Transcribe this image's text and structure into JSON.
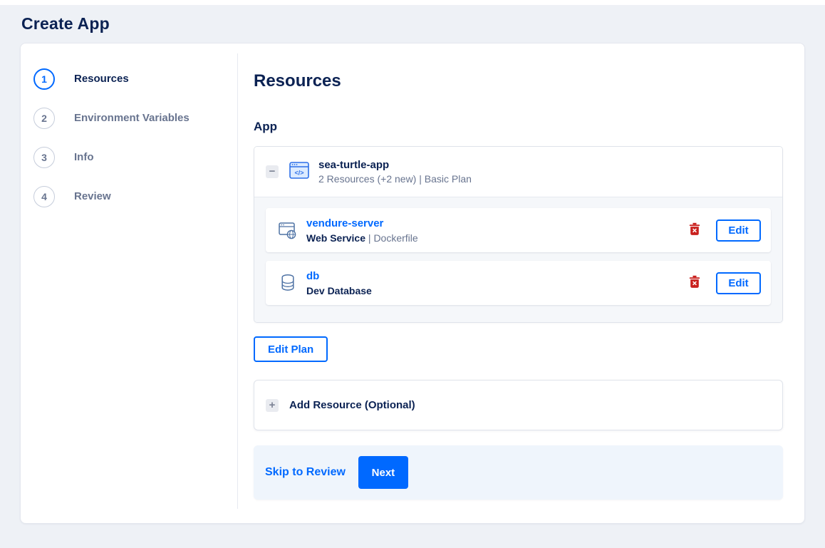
{
  "page": {
    "title": "Create App"
  },
  "stepper": {
    "steps": [
      {
        "number": "1",
        "label": "Resources",
        "active": true
      },
      {
        "number": "2",
        "label": "Environment Variables",
        "active": false
      },
      {
        "number": "3",
        "label": "Info",
        "active": false
      },
      {
        "number": "4",
        "label": "Review",
        "active": false
      }
    ]
  },
  "main": {
    "heading": "Resources",
    "section_label": "App",
    "app_group": {
      "name": "sea-turtle-app",
      "summary": "2 Resources (+2 new) | Basic Plan",
      "edit_label": "Edit",
      "resources": [
        {
          "name": "vendure-server",
          "type": "Web Service",
          "separator": " | ",
          "detail": "Dockerfile",
          "icon": "web-service-icon"
        },
        {
          "name": "db",
          "type": "Dev Database",
          "separator": "",
          "detail": "",
          "icon": "database-icon"
        }
      ]
    },
    "edit_plan_label": "Edit Plan",
    "add_resource_label": "Add Resource (Optional)",
    "footer": {
      "skip_label": "Skip to Review",
      "next_label": "Next"
    }
  },
  "icons": {
    "collapse_glyph": "−",
    "add_glyph": "+",
    "app_icon": "app-window-code",
    "delete_icon": "trash",
    "web_service_icon": "browser-globe",
    "database_icon": "db-cylinder"
  },
  "colors": {
    "accent_blue": "#0069ff",
    "heading_navy": "#0b2253",
    "muted_gray": "#68748f",
    "danger_red": "#c9211e",
    "footer_bg": "#eff5fc",
    "group_body_bg": "#f5f7fa",
    "page_bg": "#eef1f6"
  }
}
